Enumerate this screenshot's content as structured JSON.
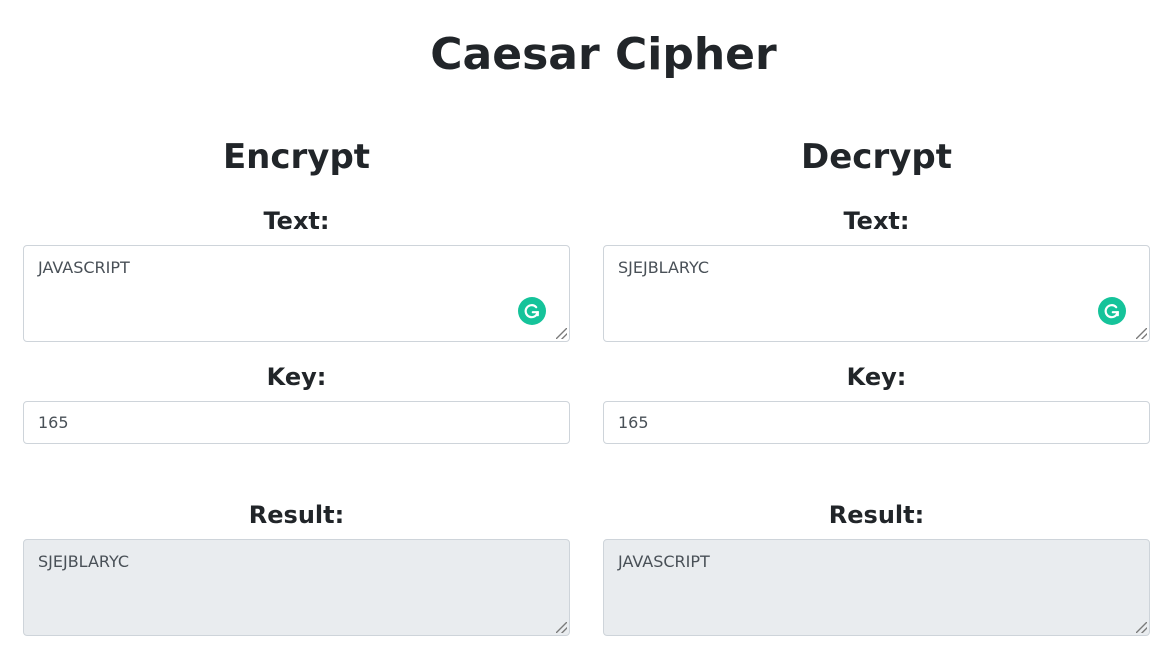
{
  "app": {
    "title": "Caesar Cipher"
  },
  "encrypt": {
    "heading": "Encrypt",
    "text_label": "Text:",
    "text_value": "JAVASCRIPT",
    "key_label": "Key:",
    "key_value": "165",
    "result_label": "Result:",
    "result_value": "SJEJBLARYC"
  },
  "decrypt": {
    "heading": "Decrypt",
    "text_label": "Text:",
    "text_value": "SJEJBLARYC",
    "key_label": "Key:",
    "key_value": "165",
    "result_label": "Result:",
    "result_value": "JAVASCRIPT"
  },
  "icons": {
    "assistant_badge": "grammarly-icon",
    "resize_handle": "resize-grip-icon"
  },
  "colors": {
    "text": "#212529",
    "field_border": "#ced4da",
    "readonly_background": "#e9ecef",
    "badge": "#15c39a"
  }
}
